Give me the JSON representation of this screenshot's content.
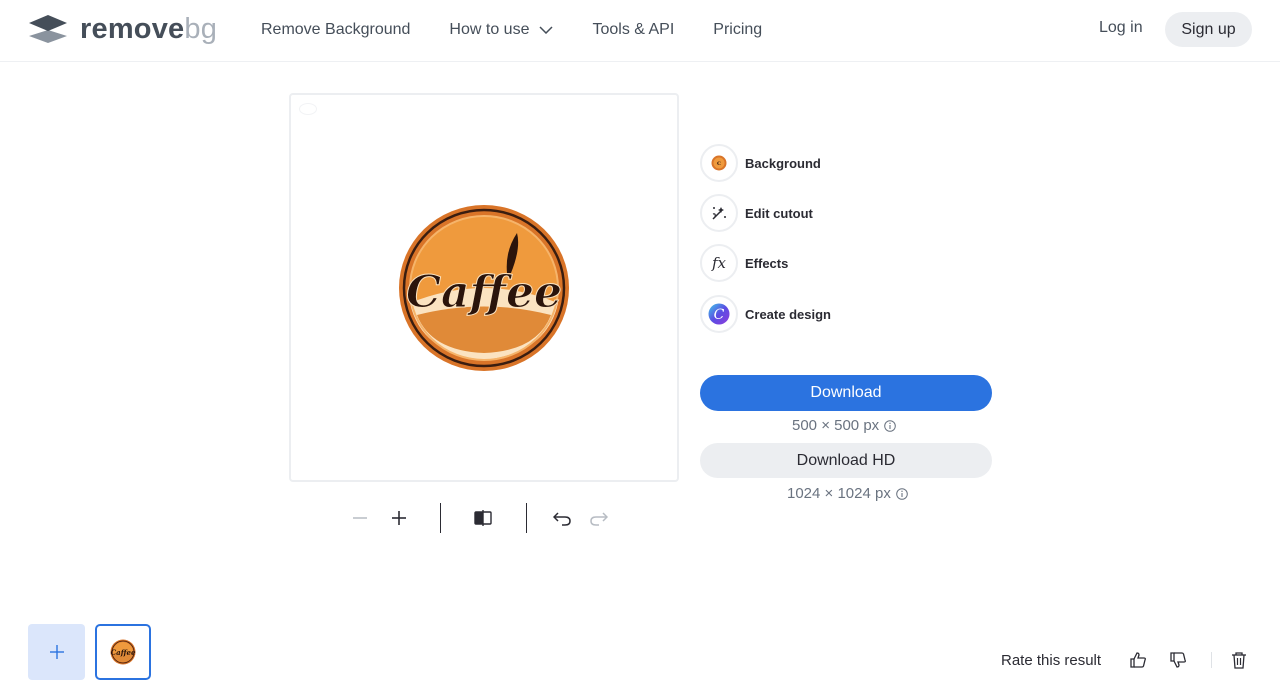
{
  "brand": {
    "name_primary": "remove",
    "name_secondary": "bg"
  },
  "nav": {
    "items": [
      {
        "label": "Remove Background"
      },
      {
        "label": "How to use"
      },
      {
        "label": "Tools & API"
      },
      {
        "label": "Pricing"
      }
    ],
    "login": "Log in",
    "signup": "Sign up"
  },
  "canvas": {
    "image_text": "Caffee"
  },
  "options": [
    {
      "label": "Background",
      "icon": "background-swatch-icon"
    },
    {
      "label": "Edit cutout",
      "icon": "magic-brush-icon"
    },
    {
      "label": "Effects",
      "icon": "fx-icon"
    },
    {
      "label": "Create design",
      "icon": "canva-icon"
    }
  ],
  "download": {
    "label": "Download",
    "size": "500 × 500 px",
    "hd_label": "Download HD",
    "hd_size": "1024 × 1024 px"
  },
  "footer": {
    "rate_label": "Rate this result"
  },
  "colors": {
    "accent": "#2b73e0",
    "text": "#2b2b33",
    "muted": "#6a7380",
    "light_bg": "#eceef1"
  }
}
